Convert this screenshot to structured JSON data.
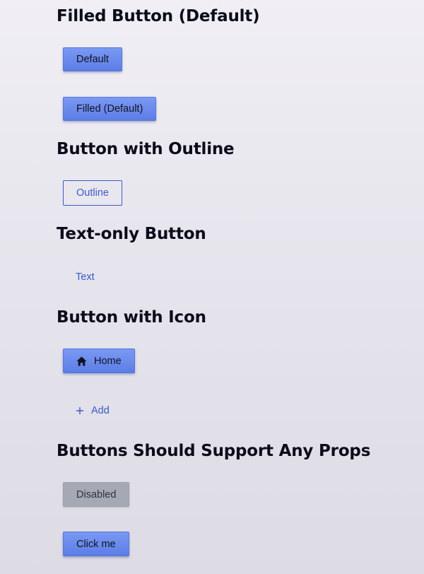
{
  "sections": {
    "filled": {
      "heading": "Filled Button (Default)",
      "buttons": [
        "Default",
        "Filled (Default)"
      ]
    },
    "outline": {
      "heading": "Button with Outline",
      "button": "Outline"
    },
    "text_only": {
      "heading": "Text-only Button",
      "button": "Text"
    },
    "with_icon": {
      "heading": "Button with Icon",
      "home_button": {
        "label": "Home",
        "icon": "home-icon"
      },
      "add_button": {
        "label": "Add",
        "icon": "plus-icon"
      }
    },
    "props": {
      "heading": "Buttons Should Support Any Props",
      "disabled_button": "Disabled",
      "click_button": "Click me"
    }
  },
  "colors": {
    "filled_button": "#6a8bec",
    "outline_and_text": "#3a5bc7",
    "disabled_button": "#a4a9b4",
    "heading_text": "#0b0c1a"
  }
}
